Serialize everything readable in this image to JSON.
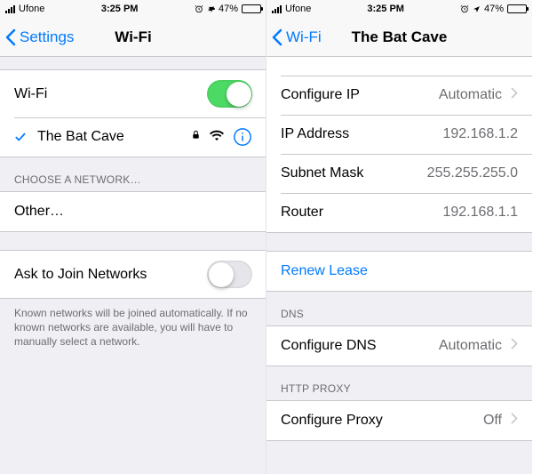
{
  "status": {
    "carrier": "Ufone",
    "time": "3:25 PM",
    "battery_pct": "47%"
  },
  "screen1": {
    "back_label": "Settings",
    "title": "Wi-Fi",
    "wifi_row_label": "Wi-Fi",
    "network_name": "The Bat Cave",
    "choose_header": "CHOOSE A NETWORK…",
    "other_label": "Other…",
    "ask_join_label": "Ask to Join Networks",
    "ask_join_on": false,
    "footer": "Known networks will be joined automatically. If no known networks are available, you will have to manually select a network."
  },
  "screen2": {
    "back_label": "Wi-Fi",
    "title": "The Bat Cave",
    "ipv4": {
      "configure_ip_label": "Configure IP",
      "configure_ip_value": "Automatic",
      "ip_address_label": "IP Address",
      "ip_address_value": "192.168.1.2",
      "subnet_label": "Subnet Mask",
      "subnet_value": "255.255.255.0",
      "router_label": "Router",
      "router_value": "192.168.1.1"
    },
    "renew_lease_label": "Renew Lease",
    "dns_header": "DNS",
    "configure_dns_label": "Configure DNS",
    "configure_dns_value": "Automatic",
    "proxy_header": "HTTP PROXY",
    "configure_proxy_label": "Configure Proxy",
    "configure_proxy_value": "Off"
  }
}
